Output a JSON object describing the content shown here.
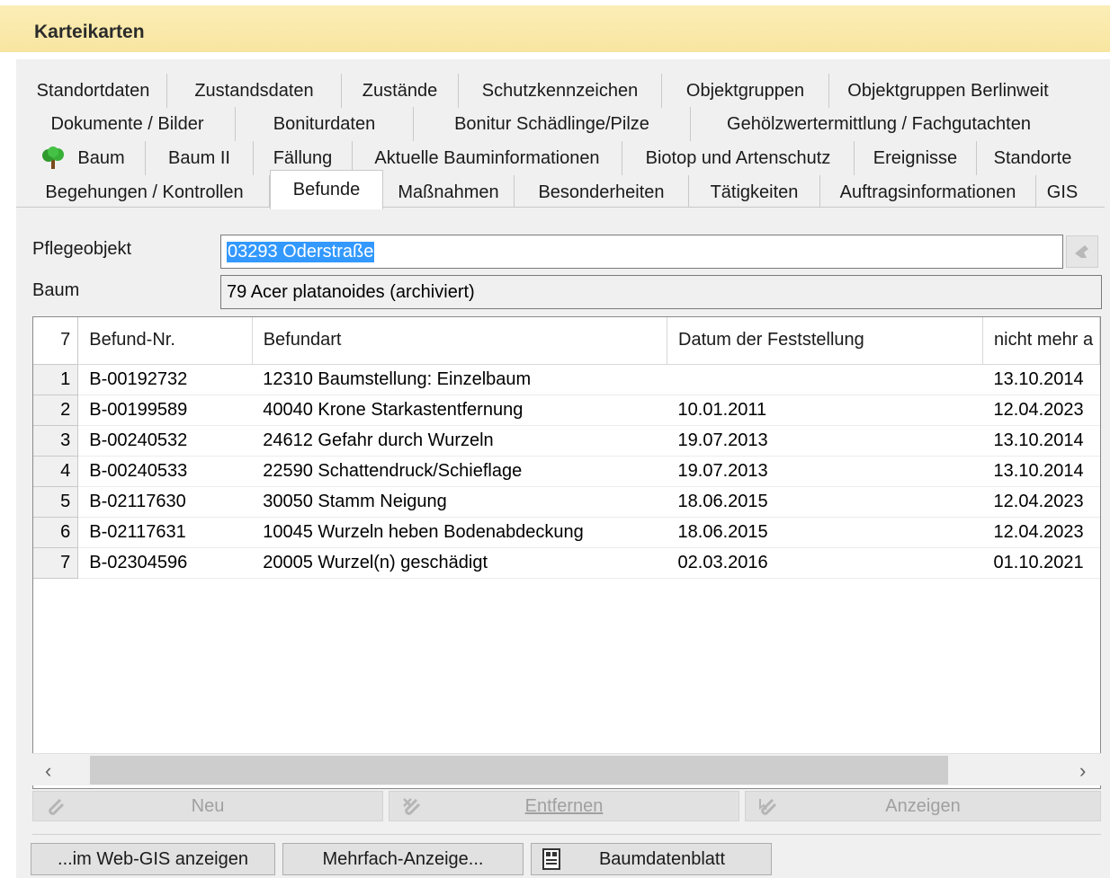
{
  "window": {
    "title": "Karteikarten"
  },
  "tabs": {
    "row1": [
      "Standortdaten",
      "Zustandsdaten",
      "Zustände",
      "Schutzkennzeichen",
      "Objektgruppen",
      "Objektgruppen Berlinweit"
    ],
    "row2": [
      "Dokumente / Bilder",
      "Boniturdaten",
      "Bonitur Schädlinge/Pilze",
      "Gehölzwertermittlung / Fachgutachten"
    ],
    "row3": [
      "Baum",
      "Baum II",
      "Fällung",
      "Aktuelle Bauminformationen",
      "Biotop und Artenschutz",
      "Ereignisse",
      "Standorte"
    ],
    "row4": [
      "Begehungen / Kontrollen",
      "Befunde",
      "Maßnahmen",
      "Besonderheiten",
      "Tätigkeiten",
      "Auftragsinformationen",
      "GIS"
    ],
    "active": "Befunde"
  },
  "form": {
    "pflegeobjekt_label": "Pflegeobjekt",
    "pflegeobjekt_value": "03293 Oderstraße",
    "baum_label": "Baum",
    "baum_value": "79 Acer platanoides (archiviert)"
  },
  "grid": {
    "count": "7",
    "columns": [
      "Befund-Nr.",
      "Befundart",
      "Datum der Feststellung",
      "nicht mehr a"
    ],
    "rows": [
      {
        "n": "1",
        "nr": "B-00192732",
        "art": "12310 Baumstellung: Einzelbaum",
        "datum": "",
        "nicht": "13.10.2014"
      },
      {
        "n": "2",
        "nr": "B-00199589",
        "art": "40040 Krone Starkastentfernung",
        "datum": "10.01.2011",
        "nicht": "12.04.2023"
      },
      {
        "n": "3",
        "nr": "B-00240532",
        "art": "24612 Gefahr durch Wurzeln",
        "datum": "19.07.2013",
        "nicht": "13.10.2014"
      },
      {
        "n": "4",
        "nr": "B-00240533",
        "art": "22590 Schattendruck/Schieflage",
        "datum": "19.07.2013",
        "nicht": "13.10.2014"
      },
      {
        "n": "5",
        "nr": "B-02117630",
        "art": "30050 Stamm Neigung",
        "datum": "18.06.2015",
        "nicht": "12.04.2023"
      },
      {
        "n": "6",
        "nr": "B-02117631",
        "art": "10045 Wurzeln heben Bodenabdeckung",
        "datum": "18.06.2015",
        "nicht": "12.04.2023"
      },
      {
        "n": "7",
        "nr": "B-02304596",
        "art": "20005 Wurzel(n) geschädigt",
        "datum": "02.03.2016",
        "nicht": "01.10.2021"
      }
    ]
  },
  "actions": {
    "neu": "Neu",
    "entfernen": "Entfernen",
    "anzeigen": "Anzeigen"
  },
  "bottom": {
    "webgis": "...im Web-GIS anzeigen",
    "mehrfach": "Mehrfach-Anzeige...",
    "baumdatenblatt": "Baumdatenblatt"
  },
  "icons": {
    "tree": "tree-icon",
    "accent": "#3399ff",
    "title_bg": "#f8e5a0"
  }
}
